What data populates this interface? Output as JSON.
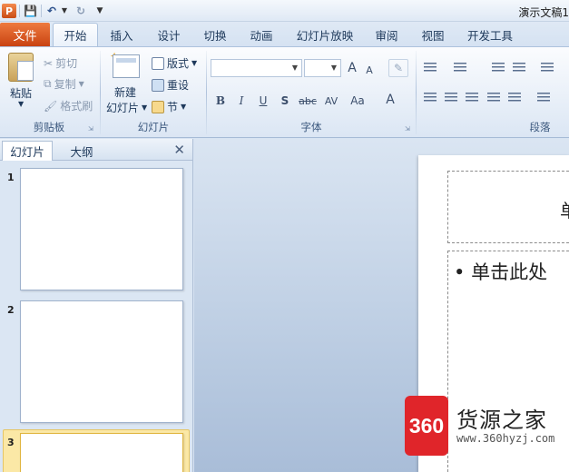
{
  "window": {
    "doc_title": "演示文稿1",
    "app_logo": "P",
    "quick_access": {
      "save_icon": "save-icon",
      "undo_icon": "undo-icon",
      "redo_icon": "redo-icon"
    }
  },
  "tabs": {
    "file": "文件",
    "items": [
      "开始",
      "插入",
      "设计",
      "切换",
      "动画",
      "幻灯片放映",
      "审阅",
      "视图",
      "开发工具"
    ],
    "active": "开始"
  },
  "ribbon": {
    "clipboard": {
      "label": "剪贴板",
      "paste": "粘贴",
      "cut": "剪切",
      "copy": "复制",
      "format_painter": "格式刷"
    },
    "slides": {
      "label": "幻灯片",
      "new_slide_line1": "新建",
      "new_slide_line2": "幻灯片",
      "layout": "版式",
      "reset": "重设",
      "section": "节"
    },
    "font": {
      "label": "字体",
      "font_name": "",
      "font_size": "",
      "bold": "B",
      "italic": "I",
      "underline": "U",
      "shadow": "S",
      "strikethrough": "abc",
      "spacing": "AV",
      "case": "Aa",
      "grow": "A",
      "shrink": "A",
      "color": "A"
    },
    "paragraph": {
      "label": "段落"
    }
  },
  "left_pane": {
    "tabs": [
      "幻灯片",
      "大纲"
    ],
    "active_tab": "幻灯片",
    "close": "✕",
    "slides": [
      "1",
      "2",
      "3"
    ],
    "selected": "3"
  },
  "slide": {
    "title_placeholder": "单",
    "body_placeholder": "单击此处"
  },
  "watermark": {
    "badge": "360",
    "title": "货源之家",
    "url": "www.360hyzj.com"
  }
}
